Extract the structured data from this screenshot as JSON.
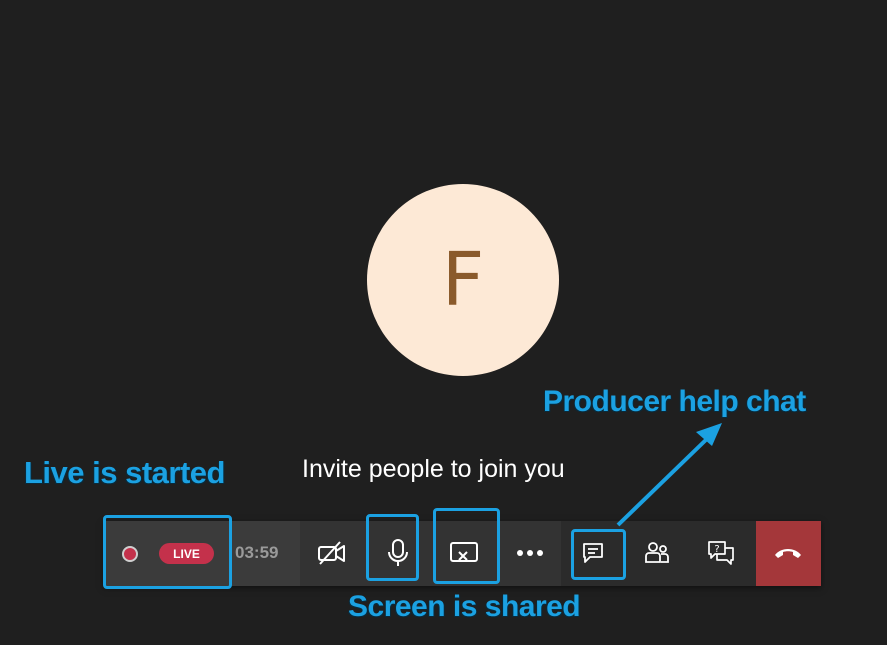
{
  "avatar": {
    "initial": "F"
  },
  "invite_text": "Invite people to join you",
  "toolbar": {
    "live_badge": "LIVE",
    "timer": "03:59",
    "icons": {
      "record": "record-icon",
      "camera_off": "camera-off-icon",
      "microphone": "microphone-icon",
      "stop_sharing": "stop-sharing-icon",
      "more": "more-actions-icon",
      "chat": "chat-icon",
      "participants": "participants-icon",
      "qa": "qa-icon",
      "leave": "hang-up-icon"
    }
  },
  "annotations": {
    "live_started": "Live is started",
    "screen_shared": "Screen is shared",
    "producer_chat": "Producer help chat"
  },
  "colors": {
    "background": "#1f1f1f",
    "avatar_bg": "#fde9d6",
    "avatar_text": "#8a5a2b",
    "live_red": "#c4314b",
    "leave_red": "#a4373a",
    "annotation_blue": "#1ba1e2"
  }
}
